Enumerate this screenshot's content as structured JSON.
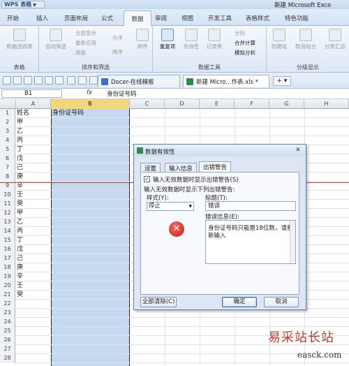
{
  "app": {
    "logo": "WPS 表格",
    "window_title": "新建 Microsoft Exce"
  },
  "ribbon_tabs": [
    "开始",
    "插入",
    "页面布局",
    "公式",
    "数据",
    "审阅",
    "视图",
    "开发工具",
    "表格样式",
    "特色功能"
  ],
  "active_tab": "数据",
  "ribbon": {
    "table_group": {
      "label": "表格",
      "pivot": "数据透视表"
    },
    "sort_group": {
      "label": "排序和筛选",
      "autofilter": "自动筛选",
      "show_all": "全部显示",
      "reapply": "重新应用",
      "advanced": "高级",
      "asc": "升序",
      "desc": "降序",
      "sort": "排序"
    },
    "tools_group": {
      "label": "数据工具",
      "duplicates": "重复项",
      "validity": "有效性",
      "record": "记录单",
      "split": "分列",
      "merge_calc": "合并计算",
      "simulate": "模拟分析"
    },
    "outline_group": {
      "label": "分级显示",
      "create": "创建组",
      "ungroup": "取消组合",
      "subtotal": "分类汇总"
    }
  },
  "doc_tabs": [
    {
      "label": "Docer-在线模板"
    },
    {
      "label": "新建 Micro...作表.xls *"
    }
  ],
  "formula_bar": {
    "name_box": "B1",
    "fx": "fx",
    "content": "身份证号码"
  },
  "columns": [
    "A",
    "B",
    "C",
    "D",
    "E",
    "F",
    "G",
    "H"
  ],
  "selected_column": "B",
  "rows": [
    {
      "n": "1",
      "a": "姓名",
      "b": "身份证号码"
    },
    {
      "n": "2",
      "a": "甲",
      "b": ""
    },
    {
      "n": "3",
      "a": "乙",
      "b": ""
    },
    {
      "n": "4",
      "a": "丙",
      "b": ""
    },
    {
      "n": "5",
      "a": "丁",
      "b": ""
    },
    {
      "n": "6",
      "a": "戊",
      "b": ""
    },
    {
      "n": "7",
      "a": "己",
      "b": ""
    },
    {
      "n": "8",
      "a": "庚",
      "b": ""
    },
    {
      "n": "9",
      "a": "辛",
      "b": ""
    },
    {
      "n": "10",
      "a": "壬",
      "b": ""
    },
    {
      "n": "11",
      "a": "癸",
      "b": ""
    },
    {
      "n": "12",
      "a": "甲",
      "b": ""
    },
    {
      "n": "13",
      "a": "乙",
      "b": ""
    },
    {
      "n": "14",
      "a": "丙",
      "b": ""
    },
    {
      "n": "15",
      "a": "丁",
      "b": ""
    },
    {
      "n": "16",
      "a": "戊",
      "b": ""
    },
    {
      "n": "17",
      "a": "己",
      "b": ""
    },
    {
      "n": "18",
      "a": "庚",
      "b": ""
    },
    {
      "n": "19",
      "a": "辛",
      "b": ""
    },
    {
      "n": "20",
      "a": "壬",
      "b": ""
    },
    {
      "n": "21",
      "a": "癸",
      "b": ""
    },
    {
      "n": "22",
      "a": "",
      "b": ""
    },
    {
      "n": "23",
      "a": "",
      "b": ""
    },
    {
      "n": "24",
      "a": "",
      "b": ""
    },
    {
      "n": "25",
      "a": "",
      "b": ""
    },
    {
      "n": "26",
      "a": "",
      "b": ""
    },
    {
      "n": "27",
      "a": "",
      "b": ""
    },
    {
      "n": "28",
      "a": "",
      "b": ""
    }
  ],
  "dialog": {
    "title": "数据有效性",
    "tabs": [
      "设置",
      "输入信息",
      "出错警告"
    ],
    "active_tab": "出错警告",
    "show_alert_checkbox": "输入无效数据时显示出错警告(S)",
    "section_label": "输入无效数据时显示下列出错警告:",
    "style_label": "样式(Y):",
    "style_value": "停止",
    "title_label": "标题(T):",
    "title_value": "错误",
    "message_label": "错误信息(E):",
    "message_value": "身份证号码只能是18位数，请重新输入",
    "clear_all": "全部清除(C)",
    "ok": "确定",
    "cancel": "取消"
  },
  "watermark": {
    "text": "易采站长站",
    "url": "easck.com"
  }
}
